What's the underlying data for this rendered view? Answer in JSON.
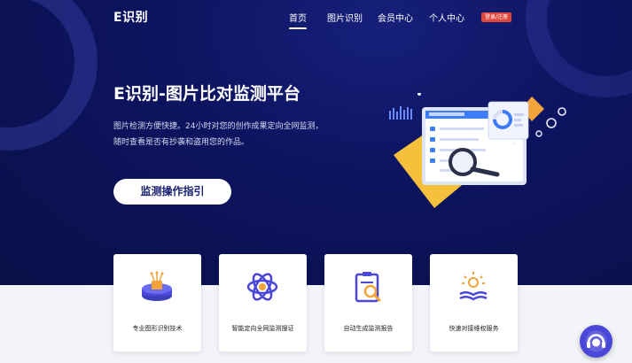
{
  "header": {
    "logo": "E识别",
    "nav": [
      {
        "label": "首页",
        "active": true
      },
      {
        "label": "图片识别",
        "active": false
      },
      {
        "label": "会员中心",
        "active": false
      },
      {
        "label": "个人中心",
        "active": false
      }
    ],
    "login_label": "登录/注册"
  },
  "hero": {
    "title": "E识别-图片比对监测平台",
    "description": "图片检测方便快捷。24小时对您的创作成果定向全网监测，随时查看是否有抄袭和盗用您的作品。",
    "cta_label": "监测操作指引"
  },
  "features": [
    {
      "label": "专业图形识别技术",
      "icon": "chip-platform-icon"
    },
    {
      "label": "智能定向全网监测搜证",
      "icon": "atom-icon"
    },
    {
      "label": "自动生成监测报告",
      "icon": "report-search-icon"
    },
    {
      "label": "快速对接维权服务",
      "icon": "book-lightbulb-icon"
    }
  ],
  "colors": {
    "hero_bg": "#0d1460",
    "accent_purple": "#4a48d8",
    "accent_orange": "#f2a33a",
    "login_red": "#e0473c"
  }
}
